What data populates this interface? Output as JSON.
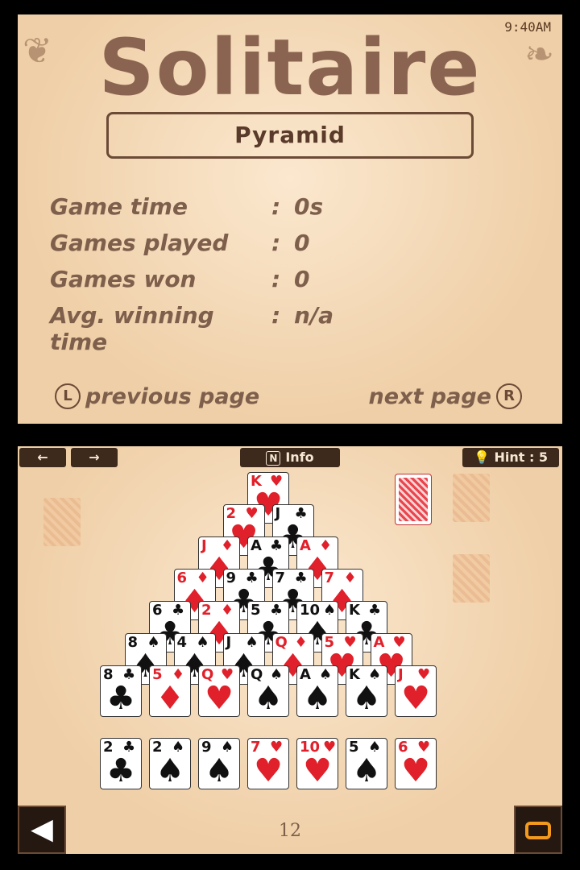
{
  "top": {
    "clock": "9:40AM",
    "title": "Solitaire",
    "mode": "Pyramid",
    "stats": [
      {
        "label": "Game time",
        "sep": ":",
        "value": "0s"
      },
      {
        "label": "Games played",
        "sep": ":",
        "value": "0"
      },
      {
        "label": "Games won",
        "sep": ":",
        "value": "0"
      },
      {
        "label": "Avg. winning time",
        "sep": ":",
        "value": "n/a"
      }
    ],
    "prev_badge": "L",
    "prev_label": "previous page",
    "next_label": "next page",
    "next_badge": "R"
  },
  "bottom": {
    "undo_icon": "←",
    "redo_icon": "→",
    "info_badge": "N",
    "info_label": "Info",
    "hint_label": "Hint : 5",
    "page_number": "12",
    "back_icon": "◀"
  },
  "pyramid": [
    [
      {
        "rank": "K",
        "suit": "♥",
        "color": "red"
      }
    ],
    [
      {
        "rank": "2",
        "suit": "♥",
        "color": "red"
      },
      {
        "rank": "J",
        "suit": "♣",
        "color": "black"
      }
    ],
    [
      {
        "rank": "J",
        "suit": "♦",
        "color": "red"
      },
      {
        "rank": "A",
        "suit": "♣",
        "color": "black"
      },
      {
        "rank": "A",
        "suit": "♦",
        "color": "red"
      }
    ],
    [
      {
        "rank": "6",
        "suit": "♦",
        "color": "red"
      },
      {
        "rank": "9",
        "suit": "♣",
        "color": "black"
      },
      {
        "rank": "7",
        "suit": "♣",
        "color": "black"
      },
      {
        "rank": "7",
        "suit": "♦",
        "color": "red"
      }
    ],
    [
      {
        "rank": "6",
        "suit": "♣",
        "color": "black"
      },
      {
        "rank": "2",
        "suit": "♦",
        "color": "red"
      },
      {
        "rank": "5",
        "suit": "♣",
        "color": "black"
      },
      {
        "rank": "10",
        "suit": "♠",
        "color": "black"
      },
      {
        "rank": "K",
        "suit": "♣",
        "color": "black"
      }
    ],
    [
      {
        "rank": "8",
        "suit": "♠",
        "color": "black"
      },
      {
        "rank": "4",
        "suit": "♠",
        "color": "black"
      },
      {
        "rank": "J",
        "suit": "♠",
        "color": "black"
      },
      {
        "rank": "Q",
        "suit": "♦",
        "color": "red"
      },
      {
        "rank": "5",
        "suit": "♥",
        "color": "red"
      },
      {
        "rank": "A",
        "suit": "♥",
        "color": "red"
      }
    ],
    [
      {
        "rank": "8",
        "suit": "♣",
        "color": "black"
      },
      {
        "rank": "5",
        "suit": "♦",
        "color": "red"
      },
      {
        "rank": "Q",
        "suit": "♥",
        "color": "red"
      },
      {
        "rank": "Q",
        "suit": "♠",
        "color": "black"
      },
      {
        "rank": "A",
        "suit": "♠",
        "color": "black"
      },
      {
        "rank": "K",
        "suit": "♠",
        "color": "black"
      },
      {
        "rank": "J",
        "suit": "♥",
        "color": "red"
      }
    ]
  ],
  "bottom_row": [
    {
      "rank": "2",
      "suit": "♣",
      "color": "black"
    },
    {
      "rank": "2",
      "suit": "♠",
      "color": "black"
    },
    {
      "rank": "9",
      "suit": "♠",
      "color": "black"
    },
    {
      "rank": "7",
      "suit": "♥",
      "color": "red"
    },
    {
      "rank": "10",
      "suit": "♥",
      "color": "red"
    },
    {
      "rank": "5",
      "suit": "♠",
      "color": "black"
    },
    {
      "rank": "6",
      "suit": "♥",
      "color": "red"
    }
  ]
}
